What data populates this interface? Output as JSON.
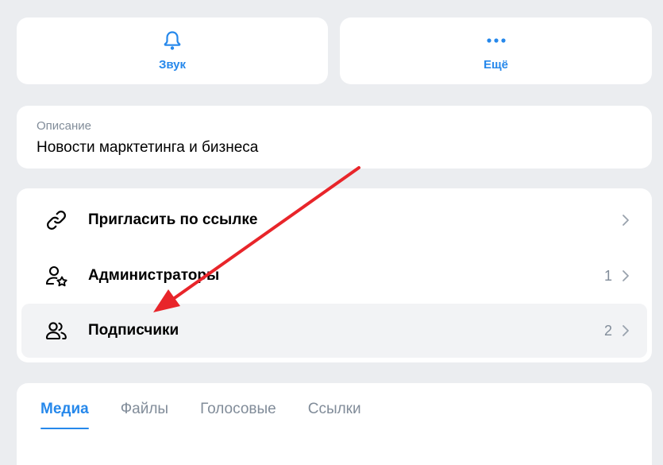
{
  "actions": [
    {
      "label": "Звук",
      "icon": "bell-icon"
    },
    {
      "label": "Ещё",
      "icon": "more-horizontal-icon"
    }
  ],
  "description": {
    "label": "Описание",
    "text": "Новости марктетинга и бизнеса"
  },
  "menu": {
    "items": [
      {
        "label": "Пригласить по ссылке",
        "icon": "link-icon",
        "count": ""
      },
      {
        "label": "Администраторы",
        "icon": "user-star-icon",
        "count": "1"
      },
      {
        "label": "Подписчики",
        "icon": "users-icon",
        "count": "2"
      }
    ]
  },
  "tabs": [
    {
      "label": "Медиа",
      "active": true
    },
    {
      "label": "Файлы",
      "active": false
    },
    {
      "label": "Голосовые",
      "active": false
    },
    {
      "label": "Ссылки",
      "active": false
    }
  ],
  "colors": {
    "accent": "#2688eb",
    "background": "#ebedf0",
    "secondary_text": "#818c99",
    "annotation_arrow": "#e8252a"
  }
}
